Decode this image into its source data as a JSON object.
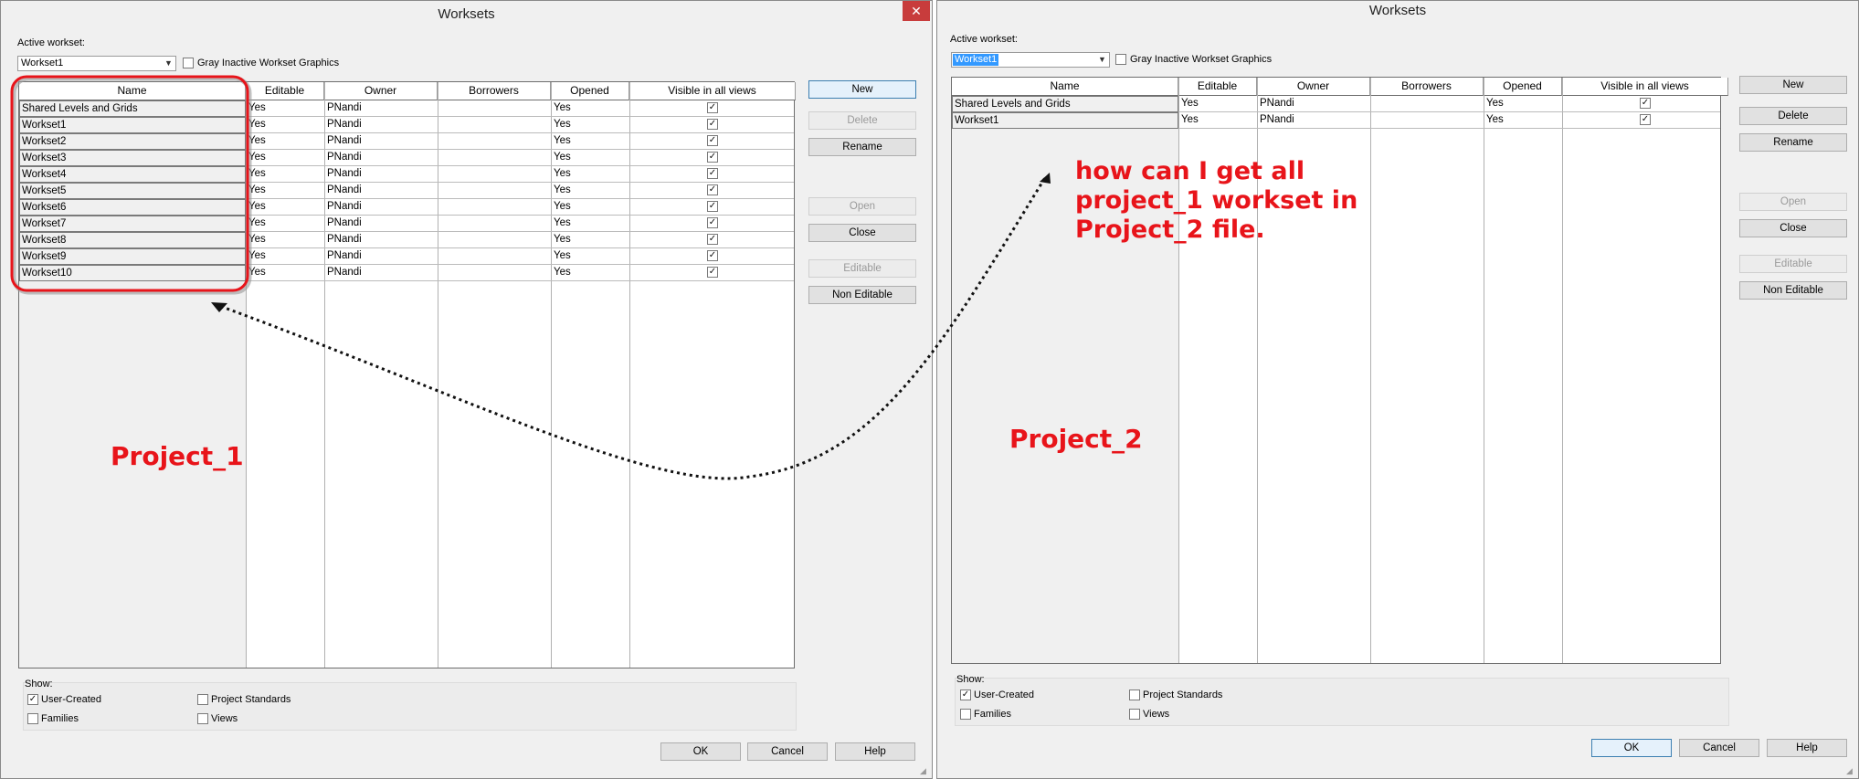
{
  "project1": {
    "window_title": "Worksets",
    "close_glyph": "✕",
    "active_workset_label": "Active workset:",
    "active_workset_value": "Workset1",
    "gray_inactive_label": "Gray Inactive Workset Graphics",
    "columns": [
      "Name",
      "Editable",
      "Owner",
      "Borrowers",
      "Opened",
      "Visible in all views"
    ],
    "rows": [
      {
        "name": "Shared Levels and Grids",
        "editable": "Yes",
        "owner": "PNandi",
        "borrowers": "",
        "opened": "Yes",
        "visible": true
      },
      {
        "name": "Workset1",
        "editable": "Yes",
        "owner": "PNandi",
        "borrowers": "",
        "opened": "Yes",
        "visible": true
      },
      {
        "name": "Workset2",
        "editable": "Yes",
        "owner": "PNandi",
        "borrowers": "",
        "opened": "Yes",
        "visible": true
      },
      {
        "name": "Workset3",
        "editable": "Yes",
        "owner": "PNandi",
        "borrowers": "",
        "opened": "Yes",
        "visible": true
      },
      {
        "name": "Workset4",
        "editable": "Yes",
        "owner": "PNandi",
        "borrowers": "",
        "opened": "Yes",
        "visible": true
      },
      {
        "name": "Workset5",
        "editable": "Yes",
        "owner": "PNandi",
        "borrowers": "",
        "opened": "Yes",
        "visible": true
      },
      {
        "name": "Workset6",
        "editable": "Yes",
        "owner": "PNandi",
        "borrowers": "",
        "opened": "Yes",
        "visible": true
      },
      {
        "name": "Workset7",
        "editable": "Yes",
        "owner": "PNandi",
        "borrowers": "",
        "opened": "Yes",
        "visible": true
      },
      {
        "name": "Workset8",
        "editable": "Yes",
        "owner": "PNandi",
        "borrowers": "",
        "opened": "Yes",
        "visible": true
      },
      {
        "name": "Workset9",
        "editable": "Yes",
        "owner": "PNandi",
        "borrowers": "",
        "opened": "Yes",
        "visible": true
      },
      {
        "name": "Workset10",
        "editable": "Yes",
        "owner": "PNandi",
        "borrowers": "",
        "opened": "Yes",
        "visible": true
      }
    ],
    "buttons": {
      "new": "New",
      "delete": "Delete",
      "rename": "Rename",
      "open": "Open",
      "close": "Close",
      "editable": "Editable",
      "non_editable": "Non Editable"
    },
    "disabled_buttons": [
      "delete",
      "open",
      "editable"
    ],
    "show": {
      "label": "Show:",
      "user_created": "User-Created",
      "user_created_checked": true,
      "families": "Families",
      "families_checked": false,
      "project_standards": "Project Standards",
      "project_standards_checked": false,
      "views": "Views",
      "views_checked": false
    },
    "footer": {
      "ok": "OK",
      "cancel": "Cancel",
      "help": "Help"
    },
    "annotation": "Project_1"
  },
  "project2": {
    "window_title": "Worksets",
    "active_workset_label": "Active workset:",
    "active_workset_value": "Workset1",
    "gray_inactive_label": "Gray Inactive Workset Graphics",
    "columns": [
      "Name",
      "Editable",
      "Owner",
      "Borrowers",
      "Opened",
      "Visible in all views"
    ],
    "rows": [
      {
        "name": "Shared Levels and Grids",
        "editable": "Yes",
        "owner": "PNandi",
        "borrowers": "",
        "opened": "Yes",
        "visible": true
      },
      {
        "name": "Workset1",
        "editable": "Yes",
        "owner": "PNandi",
        "borrowers": "",
        "opened": "Yes",
        "visible": true
      }
    ],
    "buttons": {
      "new": "New",
      "delete": "Delete",
      "rename": "Rename",
      "open": "Open",
      "close": "Close",
      "editable": "Editable",
      "non_editable": "Non Editable"
    },
    "disabled_buttons": [
      "open",
      "editable"
    ],
    "show": {
      "label": "Show:",
      "user_created": "User-Created",
      "user_created_checked": true,
      "families": "Families",
      "families_checked": false,
      "project_standards": "Project Standards",
      "project_standards_checked": false,
      "views": "Views",
      "views_checked": false
    },
    "footer": {
      "ok": "OK",
      "cancel": "Cancel",
      "help": "Help"
    },
    "annotation": "Project_2"
  },
  "question_lines": [
    "how can I get all",
    "project_1 workset in",
    "Project_2 file."
  ],
  "colors": {
    "annotation_red": "#e8141a",
    "dialog_bg": "#f0f0f0",
    "selection_blue": "#3399ff",
    "close_red": "#c83c3c"
  },
  "check_glyph": "✓"
}
